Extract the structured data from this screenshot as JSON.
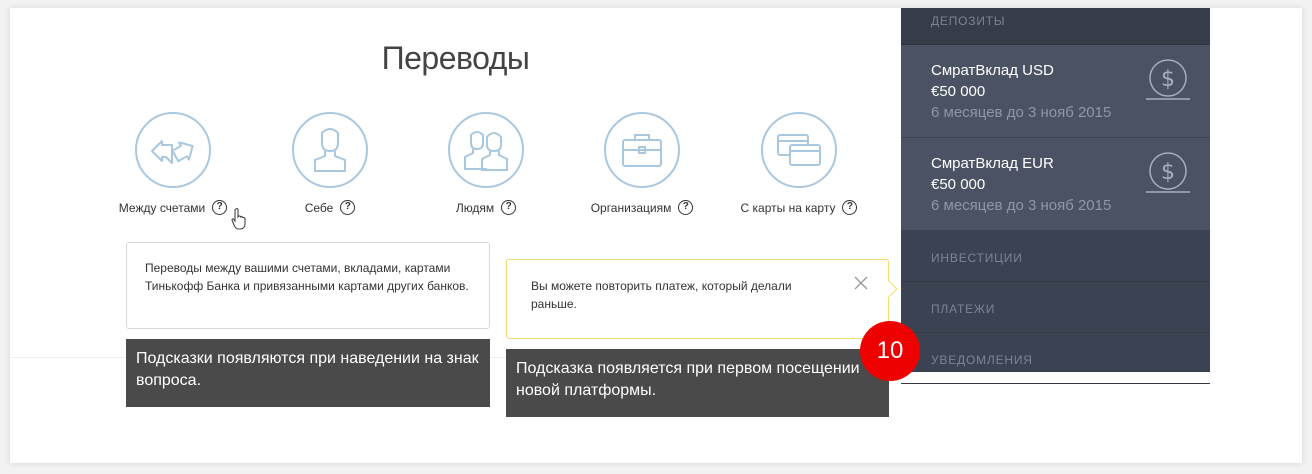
{
  "page": {
    "title": "Переводы"
  },
  "categories": [
    {
      "label": "Между счетами",
      "icon": "arrows-exchange-icon"
    },
    {
      "label": "Себе",
      "icon": "person-icon"
    },
    {
      "label": "Людям",
      "icon": "people-icon"
    },
    {
      "label": "Организациям",
      "icon": "briefcase-icon"
    },
    {
      "label": "С карты на карту",
      "icon": "cards-icon"
    }
  ],
  "help_mark": "?",
  "tooltips": {
    "accounts": "Переводы между вашими счетами, вкладами, картами Тинькофф Банка и привязанными картами других банков.",
    "repeat": "Вы можете повторить платеж, который делали раньше."
  },
  "sidebar": {
    "header": "ДЕПОЗИТЫ",
    "deposits": [
      {
        "name": "СмратВклад USD",
        "amount": "€50 000",
        "term": "6 месяцев до 3 нояб 2015"
      },
      {
        "name": "СмратВклад EUR",
        "amount": "€50 000",
        "term": "6 месяцев до 3 нояб 2015"
      }
    ],
    "menu": [
      "ИНВЕСТИЦИИ",
      "ПЛАТЕЖИ",
      "УВЕДОМЛЕНИЯ"
    ]
  },
  "annotations": {
    "note1": "Подсказки появляются при наведении на знак вопроса.",
    "note2": "Подсказка появляется  при первом посещении новой платформы.",
    "badge": "10"
  },
  "colors": {
    "accent_icon": "#a9c8e0",
    "sidebar_bg": "#3b4252",
    "deposit_bg": "#4b5263",
    "badge": "#ee0000",
    "tip_border": "#f2dc6c"
  }
}
